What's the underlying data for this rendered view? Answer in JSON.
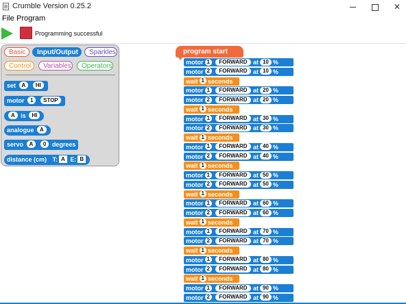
{
  "window": {
    "title": "Crumble Version 0.25.2",
    "minimize": "",
    "maximize": "",
    "close": "✕"
  },
  "menu": {
    "file": "File",
    "program": "Program"
  },
  "toolbar": {
    "status": "Programming successful"
  },
  "palette": {
    "categories": [
      {
        "label": "Basic",
        "color": "#e8553a"
      },
      {
        "label": "Input/Output",
        "color": "#1b7fd4"
      },
      {
        "label": "Sparkles",
        "color": "#6a4fb8"
      },
      {
        "label": "Control",
        "color": "#f5901b"
      },
      {
        "label": "Variables",
        "color": "#b553a6"
      },
      {
        "label": "Operators",
        "color": "#3db84a"
      }
    ],
    "blocks": {
      "set": {
        "label": "set",
        "pin": "A",
        "value": "HI"
      },
      "motor": {
        "label": "motor",
        "num": "1",
        "dir": "STOP"
      },
      "is": {
        "pin": "A",
        "label": "is",
        "value": "HI"
      },
      "analogue": {
        "label": "analogue",
        "pin": "A"
      },
      "servo": {
        "label": "servo",
        "pin": "A",
        "value": "0",
        "unit": "degrees"
      },
      "distance": {
        "label": "distance (cm)",
        "t_label": "T:",
        "t_pin": "A",
        "e_label": "E:",
        "e_pin": "B"
      }
    }
  },
  "script": {
    "start": "program start",
    "labels": {
      "motor": "motor",
      "at": "at",
      "percent": "%",
      "wait": "wait",
      "seconds": "seconds"
    },
    "groups": [
      {
        "speed": "10",
        "direction": "FORWARD",
        "wait": "1"
      },
      {
        "speed": "20",
        "direction": "FORWARD",
        "wait": "1"
      },
      {
        "speed": "30",
        "direction": "FORWARD",
        "wait": "1"
      },
      {
        "speed": "40",
        "direction": "FORWARD",
        "wait": "1"
      },
      {
        "speed": "50",
        "direction": "FORWARD",
        "wait": "1"
      },
      {
        "speed": "60",
        "direction": "FORWARD",
        "wait": "1"
      },
      {
        "speed": "70",
        "direction": "FORWARD",
        "wait": "1"
      },
      {
        "speed": "80",
        "direction": "FORWARD",
        "wait": "1"
      },
      {
        "speed": "90",
        "direction": "FORWARD",
        "wait": null
      }
    ]
  }
}
